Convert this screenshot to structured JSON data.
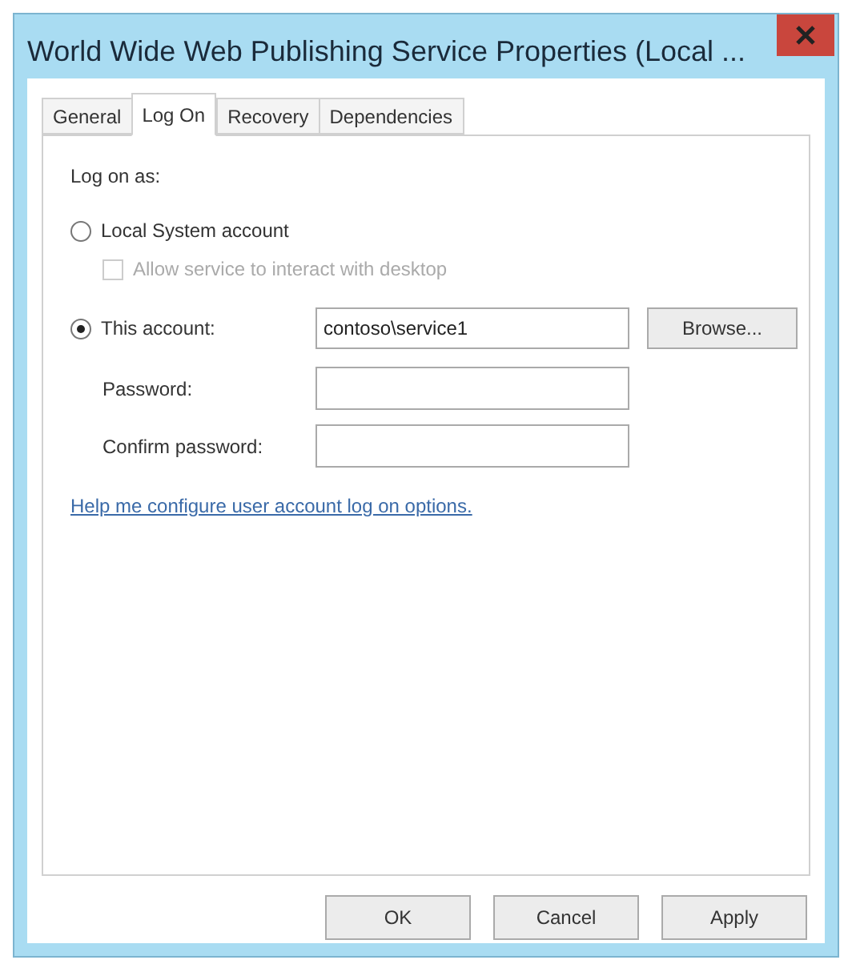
{
  "window": {
    "title": "World Wide Web Publishing Service Properties (Local ..."
  },
  "tabs": [
    {
      "label": "General",
      "selected": false
    },
    {
      "label": "Log On",
      "selected": true
    },
    {
      "label": "Recovery",
      "selected": false
    },
    {
      "label": "Dependencies",
      "selected": false
    }
  ],
  "log_on": {
    "heading": "Log on as:",
    "options": [
      {
        "label": "Local System account",
        "selected": false
      },
      {
        "label": "This account:",
        "selected": true
      }
    ],
    "interact_checkbox": {
      "label": "Allow service to interact with desktop",
      "checked": false,
      "disabled": true
    },
    "account_field": {
      "value": "contoso\\service1"
    },
    "browse_button": "Browse...",
    "password_label": "Password:",
    "confirm_label": "Confirm password:",
    "help_link": "Help me configure user account log on options."
  },
  "buttons": [
    "OK",
    "Cancel",
    "Apply"
  ]
}
